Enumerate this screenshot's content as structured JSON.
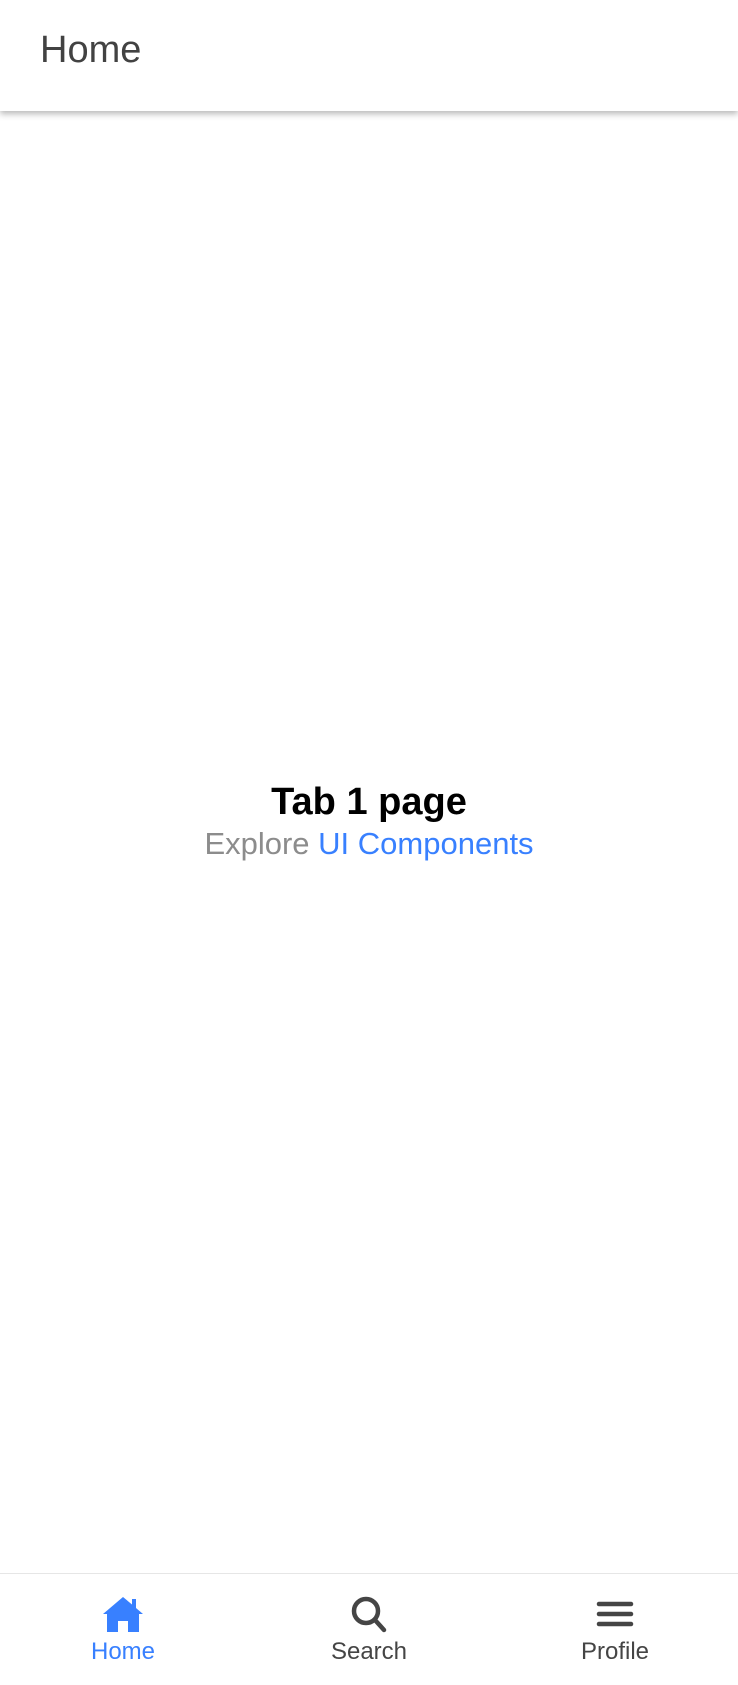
{
  "header": {
    "title": "Home"
  },
  "main": {
    "heading": "Tab 1 page",
    "explore_prefix": "Explore ",
    "explore_link": "UI Components"
  },
  "tabbar": {
    "active_tab": "home",
    "tabs": [
      {
        "id": "home",
        "label": "Home",
        "icon": "home-icon"
      },
      {
        "id": "search",
        "label": "Search",
        "icon": "search-icon"
      },
      {
        "id": "profile",
        "label": "Profile",
        "icon": "menu-icon"
      }
    ]
  },
  "colors": {
    "accent": "#3880ff",
    "inactive_tab": "#454545",
    "muted_text": "#8c8c8c",
    "header_text": "#424242"
  }
}
